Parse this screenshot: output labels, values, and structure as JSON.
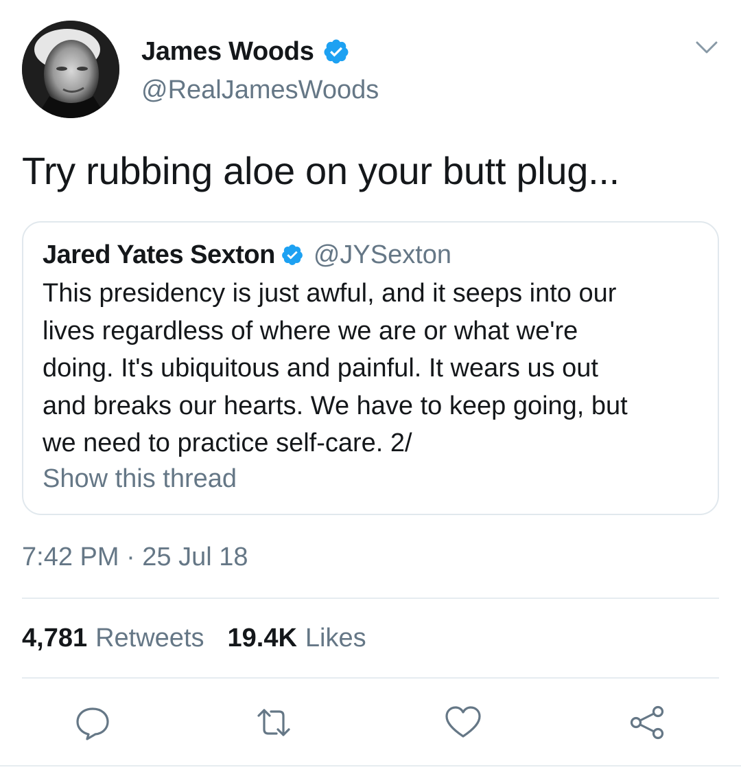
{
  "author": {
    "name": "James Woods",
    "handle": "@RealJamesWoods",
    "verified": true
  },
  "tweet": {
    "text": "Try rubbing aloe on your butt plug..."
  },
  "quoted_tweet": {
    "name": "Jared Yates Sexton",
    "handle": "@JYSexton",
    "verified": true,
    "lines": [
      "This presidency is just awful, and it seeps into our",
      "lives regardless of where we are or what we're",
      "doing. It's ubiquitous and painful. It wears us out",
      "and breaks our hearts. We have to keep going, but",
      "we need to practice self-care. 2/"
    ],
    "show_thread_label": "Show this thread"
  },
  "timestamp": "7:42 PM · 25 Jul 18",
  "stats": {
    "retweets_count": "4,781",
    "retweets_label": "Retweets",
    "likes_count": "19.4K",
    "likes_label": "Likes"
  },
  "icons": {
    "verified": "verified-badge-icon",
    "caret": "chevron-down-icon",
    "reply": "reply-icon",
    "retweet": "retweet-icon",
    "like": "heart-icon",
    "share": "share-icon"
  },
  "colors": {
    "primary_text": "#14171a",
    "secondary_text": "#657786",
    "verified_blue": "#1da1f2",
    "border": "#e1e8ed",
    "icon_gray": "#657786"
  }
}
